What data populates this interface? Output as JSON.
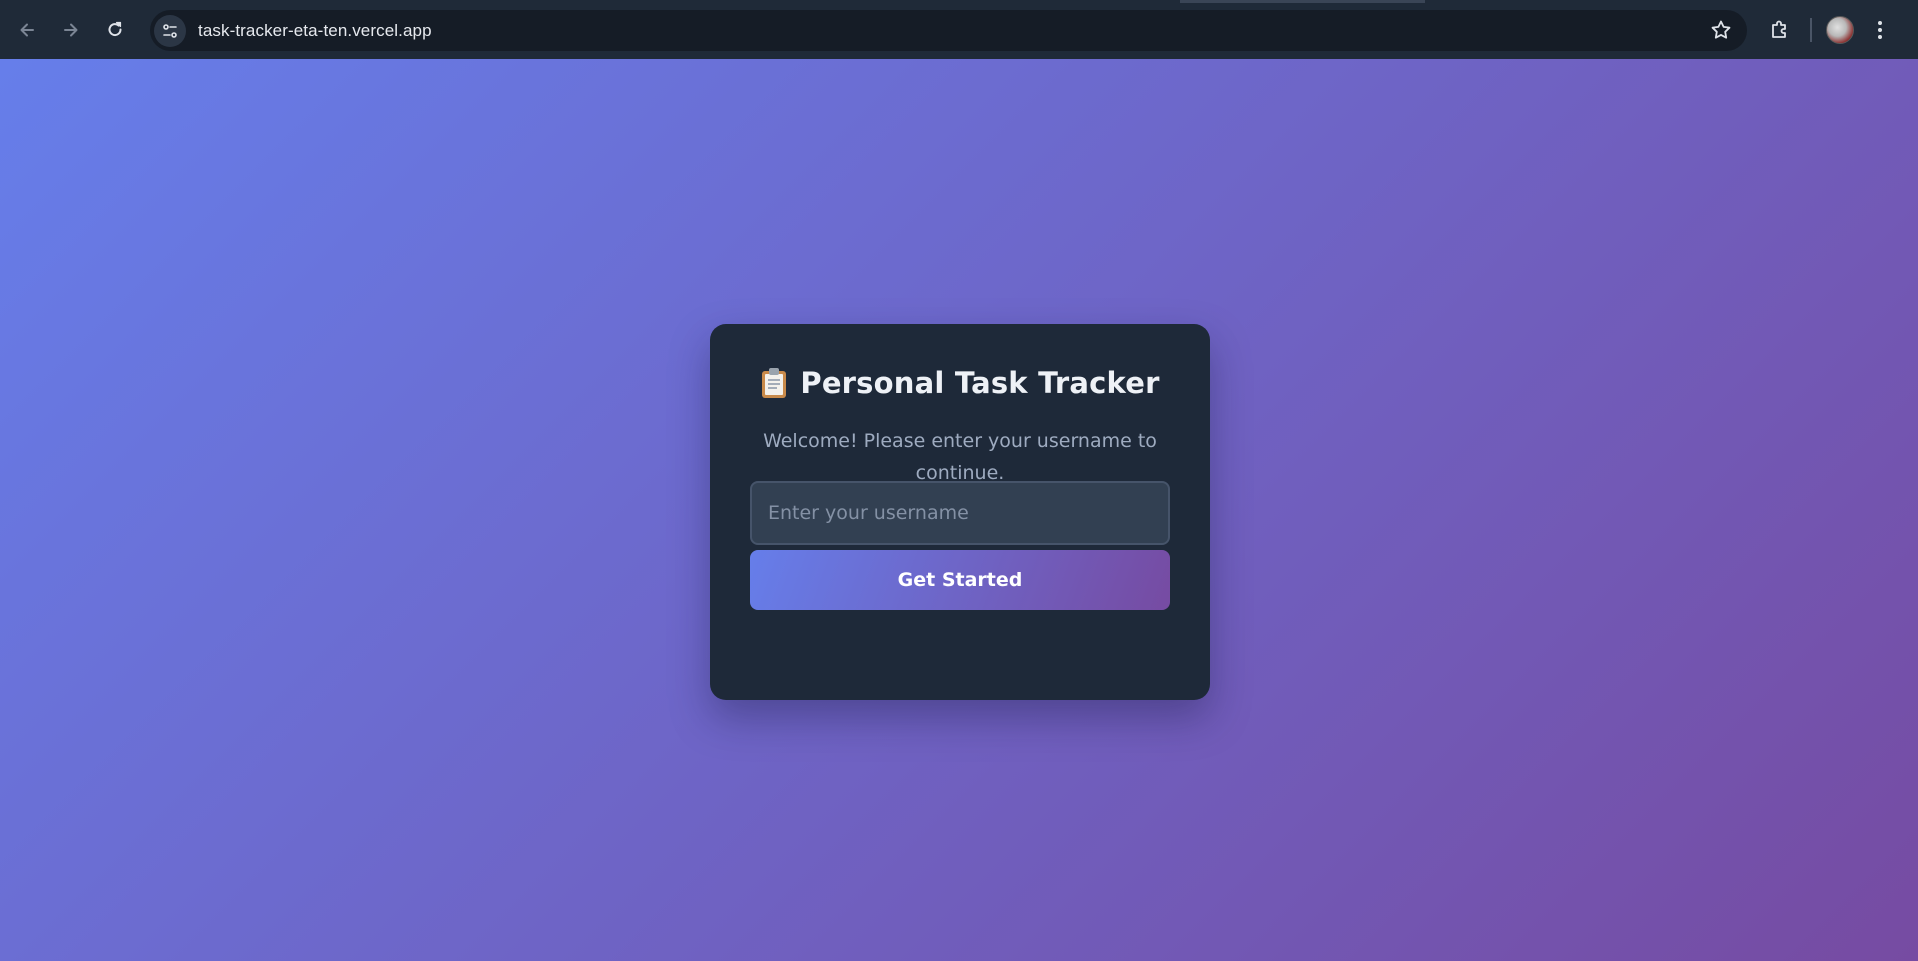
{
  "browser": {
    "url": "task-tracker-eta-ten.vercel.app",
    "icons": {
      "back": "arrow-left-icon",
      "forward": "arrow-right-icon",
      "reload": "reload-icon",
      "site_info": "tune-icon",
      "bookmark": "star-icon",
      "extensions": "puzzle-icon",
      "menu": "kebab-menu-icon"
    }
  },
  "page": {
    "background_colors": [
      "#667eea",
      "#764ba2"
    ]
  },
  "login_card": {
    "title_icon": "clipboard-icon",
    "title": "Personal Task Tracker",
    "subtitle": "Welcome! Please enter your username to continue.",
    "username_input": {
      "placeholder": "Enter your username",
      "value": ""
    },
    "submit_label": "Get Started",
    "card_color": "#1e2939"
  }
}
